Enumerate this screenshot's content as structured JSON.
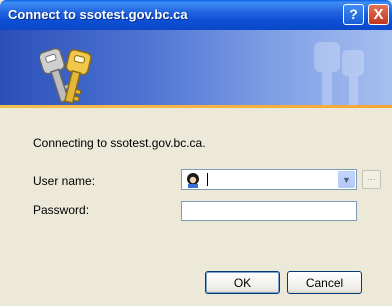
{
  "window": {
    "title": "Connect to ssotest.gov.bc.ca",
    "help_button": "?",
    "close_button": "X"
  },
  "message": "Connecting to ssotest.gov.bc.ca.",
  "form": {
    "username_label": "User name:",
    "username_value": "",
    "password_label": "Password:",
    "password_value": "",
    "browse_button": "..."
  },
  "buttons": {
    "ok": "OK",
    "cancel": "Cancel"
  },
  "icons": {
    "banner": "keys-icon",
    "watermark": "keys-watermark-icon",
    "user": "user-avatar-icon",
    "dropdown": "chevron-down-icon"
  },
  "colors": {
    "titlebar": "#0a48c6",
    "banner": "#4b72d2",
    "accent_line": "#f4a53a",
    "dialog_bg": "#ece9d8"
  }
}
